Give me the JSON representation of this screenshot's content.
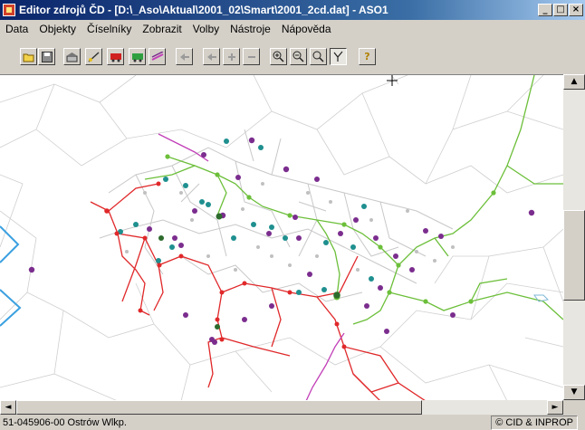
{
  "window": {
    "title": "Editor zdrojů ČD - [D:\\_Aso\\Aktual\\2001_02\\Smart\\2001_2cd.dat] - ASO1",
    "minimize": "_",
    "maximize": "□",
    "close": "×"
  },
  "menu": [
    {
      "label": "Data"
    },
    {
      "label": "Objekty"
    },
    {
      "label": "Číselníky"
    },
    {
      "label": "Zobrazit"
    },
    {
      "label": "Volby"
    },
    {
      "label": "Nástroje"
    },
    {
      "label": "Nápověda"
    }
  ],
  "toolbar": {
    "buttons": [
      {
        "icon": "open-folder-icon"
      },
      {
        "icon": "save-icon"
      },
      {
        "icon": "station-icon"
      },
      {
        "icon": "edit-line-icon"
      },
      {
        "icon": "train-red-icon"
      },
      {
        "icon": "train-green-icon"
      },
      {
        "icon": "tracks-icon"
      },
      {
        "icon": "back-arrow-icon"
      },
      {
        "icon": "delete-icon"
      },
      {
        "icon": "plus-icon"
      },
      {
        "icon": "minus-icon"
      },
      {
        "icon": "zoom-in-icon"
      },
      {
        "icon": "zoom-out-icon"
      },
      {
        "icon": "zoom-icon"
      },
      {
        "icon": "select-branch-icon"
      },
      {
        "icon": "help-icon"
      }
    ],
    "zoom_in_glyph": "+",
    "zoom_out_glyph": "−",
    "help_glyph": "?"
  },
  "map": {
    "colors": {
      "red": "#e0282a",
      "green": "#6cbf3a",
      "magenta": "#c23fb8",
      "purple": "#7b2d8e",
      "teal": "#1f8f8f",
      "gray": "#c8c8c8",
      "darkgreen": "#2d6b2d"
    }
  },
  "status": {
    "left": "51-045906-00  Ostrów Wlkp.",
    "right": "© CID & INPROP"
  },
  "scroll": {
    "up": "▲",
    "down": "▼",
    "left": "◄",
    "right": "►"
  }
}
